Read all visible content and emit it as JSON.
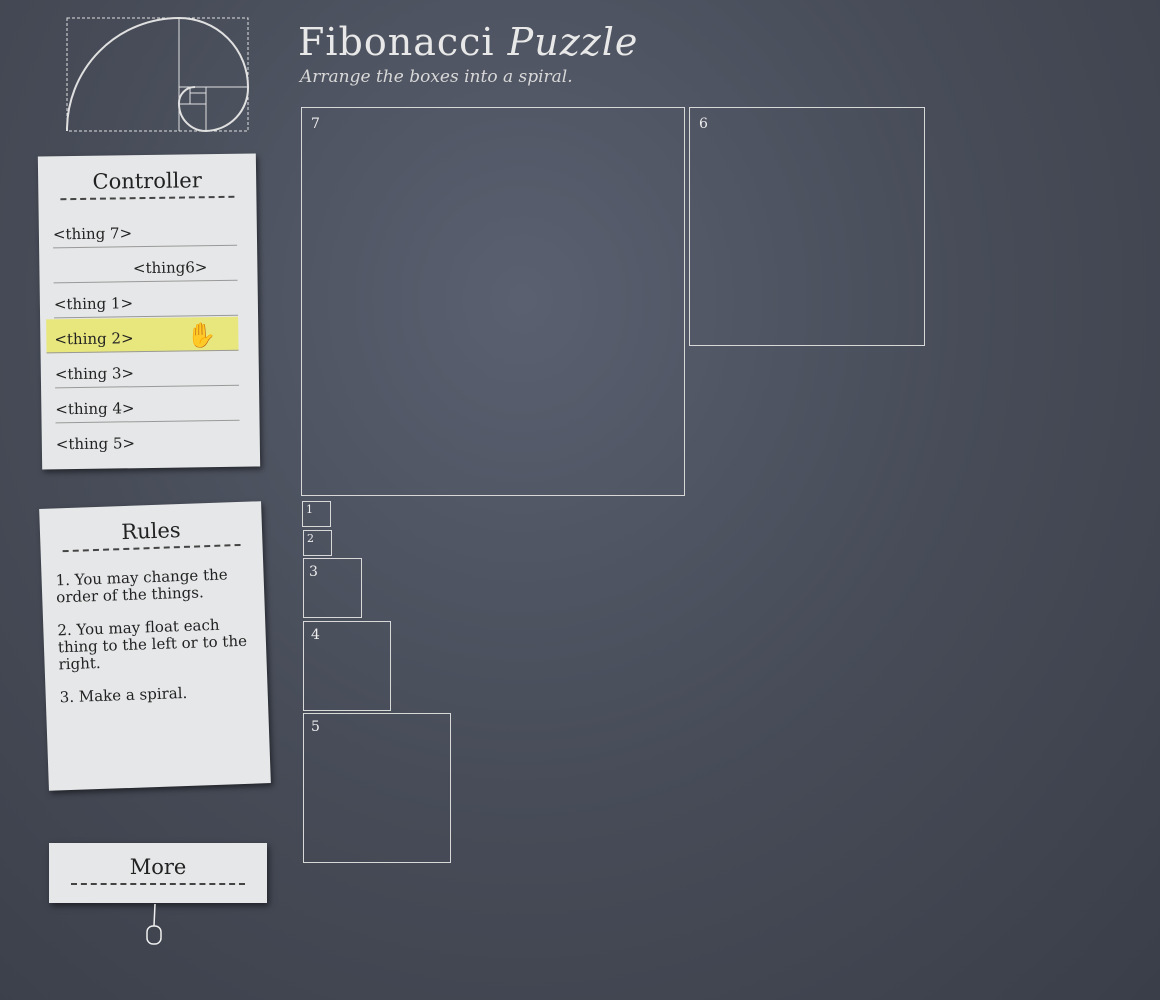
{
  "header": {
    "title_main": "Fibonacci",
    "title_italic": "Puzzle",
    "subtitle": "Arrange the boxes into a spiral."
  },
  "controller": {
    "title": "Controller",
    "items": [
      {
        "label": "<thing 7>",
        "float": "left"
      },
      {
        "label": "<thing6>",
        "float": "right"
      },
      {
        "label": "<thing 1>",
        "float": "left"
      },
      {
        "label": "<thing 2>",
        "float": "left",
        "selected": true
      },
      {
        "label": "<thing 3>",
        "float": "left"
      },
      {
        "label": "<thing 4>",
        "float": "left"
      },
      {
        "label": "<thing 5>",
        "float": "left"
      }
    ]
  },
  "rules": {
    "title": "Rules",
    "items": [
      "1. You may change the order of the things.",
      "2. You may float each thing to the left or to the right.",
      "3. Make a spiral."
    ]
  },
  "more": {
    "title": "More"
  },
  "boxes": [
    "7",
    "6",
    "1",
    "2",
    "3",
    "4",
    "5"
  ]
}
